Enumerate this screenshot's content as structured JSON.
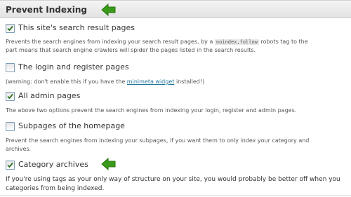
{
  "panel": {
    "title": "Prevent Indexing"
  },
  "options": [
    {
      "label": "This site's search result pages",
      "checked": true,
      "desc_before_code": "Prevents the search engines from indexing your search result pages, by a",
      "code": "noindex,follow",
      "desc_after_code": "robots tag to the",
      "desc_line2": "part means that search engine crawlers will spider the pages listed in the search results."
    },
    {
      "label": "The login and register pages",
      "checked": false,
      "desc_before_link": "(warning: don't enable this if you have the",
      "link": "minimeta widget",
      "desc_after_link": "installed!)"
    },
    {
      "label": "All admin pages",
      "checked": true,
      "desc": "The above two options prevent the search engines from indexing your login, register and admin pages."
    },
    {
      "label": "Subpages of the homepage",
      "checked": false,
      "desc_line1": "Prevent the search engines from indexing your subpages, if you want them to only index your category and",
      "desc_line2": "archives."
    },
    {
      "label": "Category archives",
      "checked": true,
      "desc_line1": "If you're using tags as your only way of structure on your site, you would probably be better off when you",
      "desc_line2": "categories from being indexed."
    }
  ],
  "colors": {
    "arrow": "#3a9a1a",
    "link": "#21759b",
    "checkmark": "#2a6e1e"
  },
  "icons": {
    "header_arrow": "green-arrow-icon",
    "category_arrow": "green-arrow-icon"
  }
}
